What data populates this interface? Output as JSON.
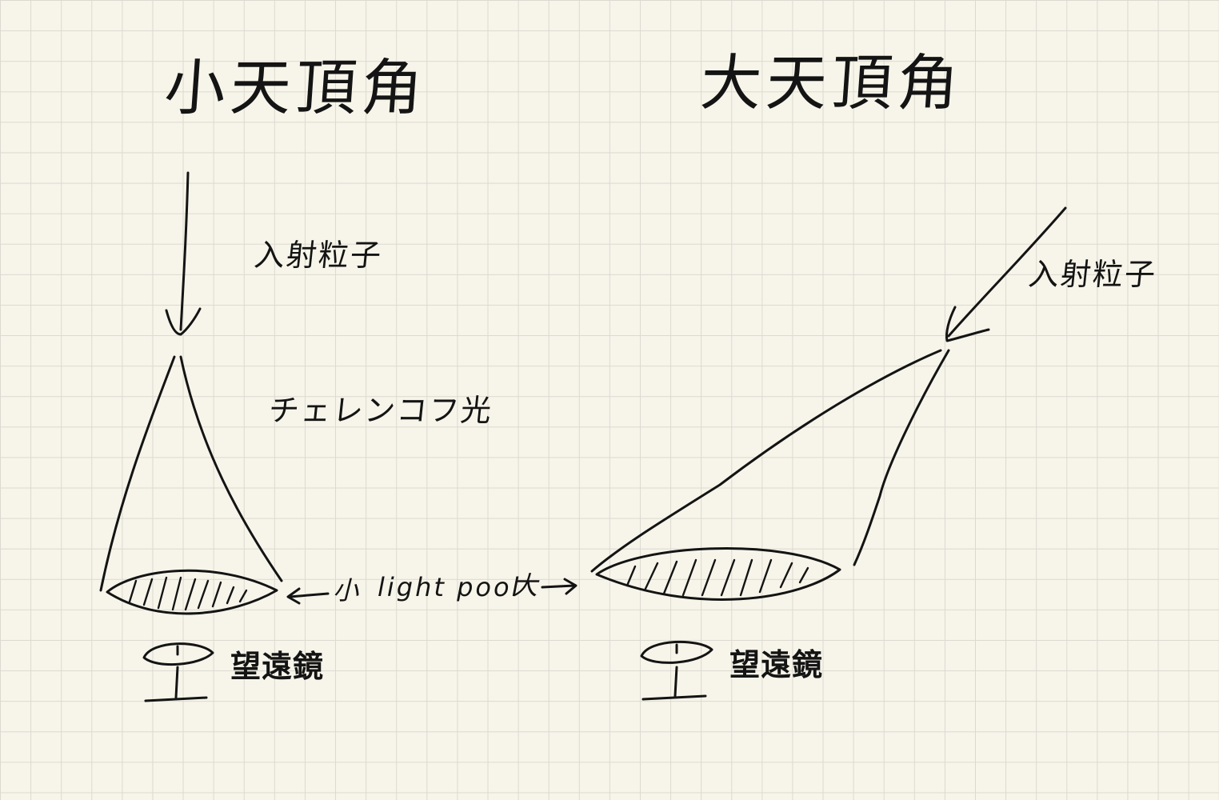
{
  "left_panel": {
    "title": "小天頂角",
    "particle_label": "入射粒子",
    "cherenkov_label": "チェレンコフ光",
    "telescope_label": "望遠鏡"
  },
  "right_panel": {
    "title": "大天頂角",
    "particle_label": "入射粒子",
    "telescope_label": "望遠鏡"
  },
  "light_pool": {
    "small_label": "小",
    "text": "light pool",
    "large_label": "大"
  },
  "colors": {
    "paper": "#f7f5ea",
    "grid": "#dcdad0",
    "ink": "#141414"
  }
}
